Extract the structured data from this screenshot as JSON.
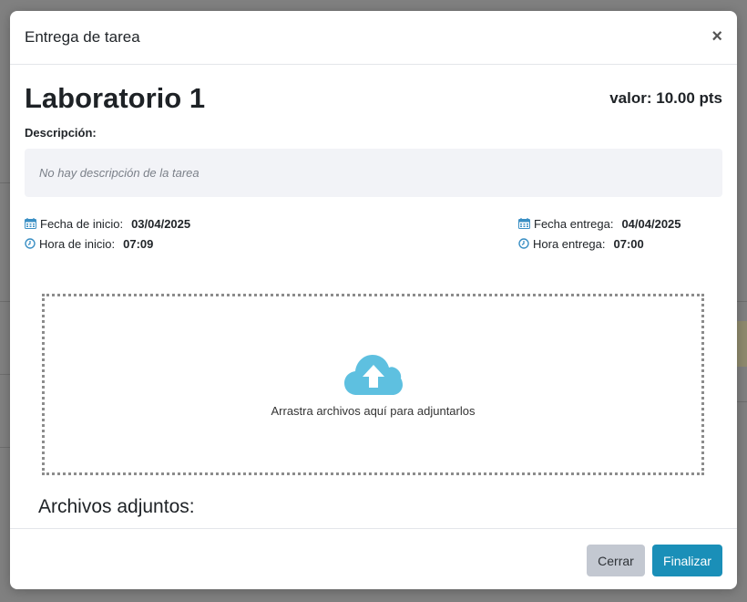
{
  "modal": {
    "title": "Entrega de tarea",
    "close_label": "×"
  },
  "task": {
    "name": "Laboratorio 1",
    "value": "valor: 10.00 pts",
    "description_label": "Descripción:",
    "description": "No hay descripción de la tarea"
  },
  "dates": {
    "start_date_label": "Fecha de inicio:",
    "start_date": "03/04/2025",
    "start_time_label": "Hora de inicio:",
    "start_time": "07:09",
    "due_date_label": "Fecha entrega:",
    "due_date": "04/04/2025",
    "due_time_label": "Hora entrega:",
    "due_time": "07:00"
  },
  "dropzone": {
    "text": "Arrastra archivos aquí para adjuntarlos",
    "icon": "cloud-upload-icon"
  },
  "attachments": {
    "title": "Archivos adjuntos:"
  },
  "footer": {
    "cancel_label": "Cerrar",
    "finish_label": "Finalizar"
  },
  "colors": {
    "accent": "#1a8fb8",
    "icon": "#3a8fc4",
    "cloud": "#5ec0e0",
    "cancel_bg": "#c3c8d1"
  }
}
